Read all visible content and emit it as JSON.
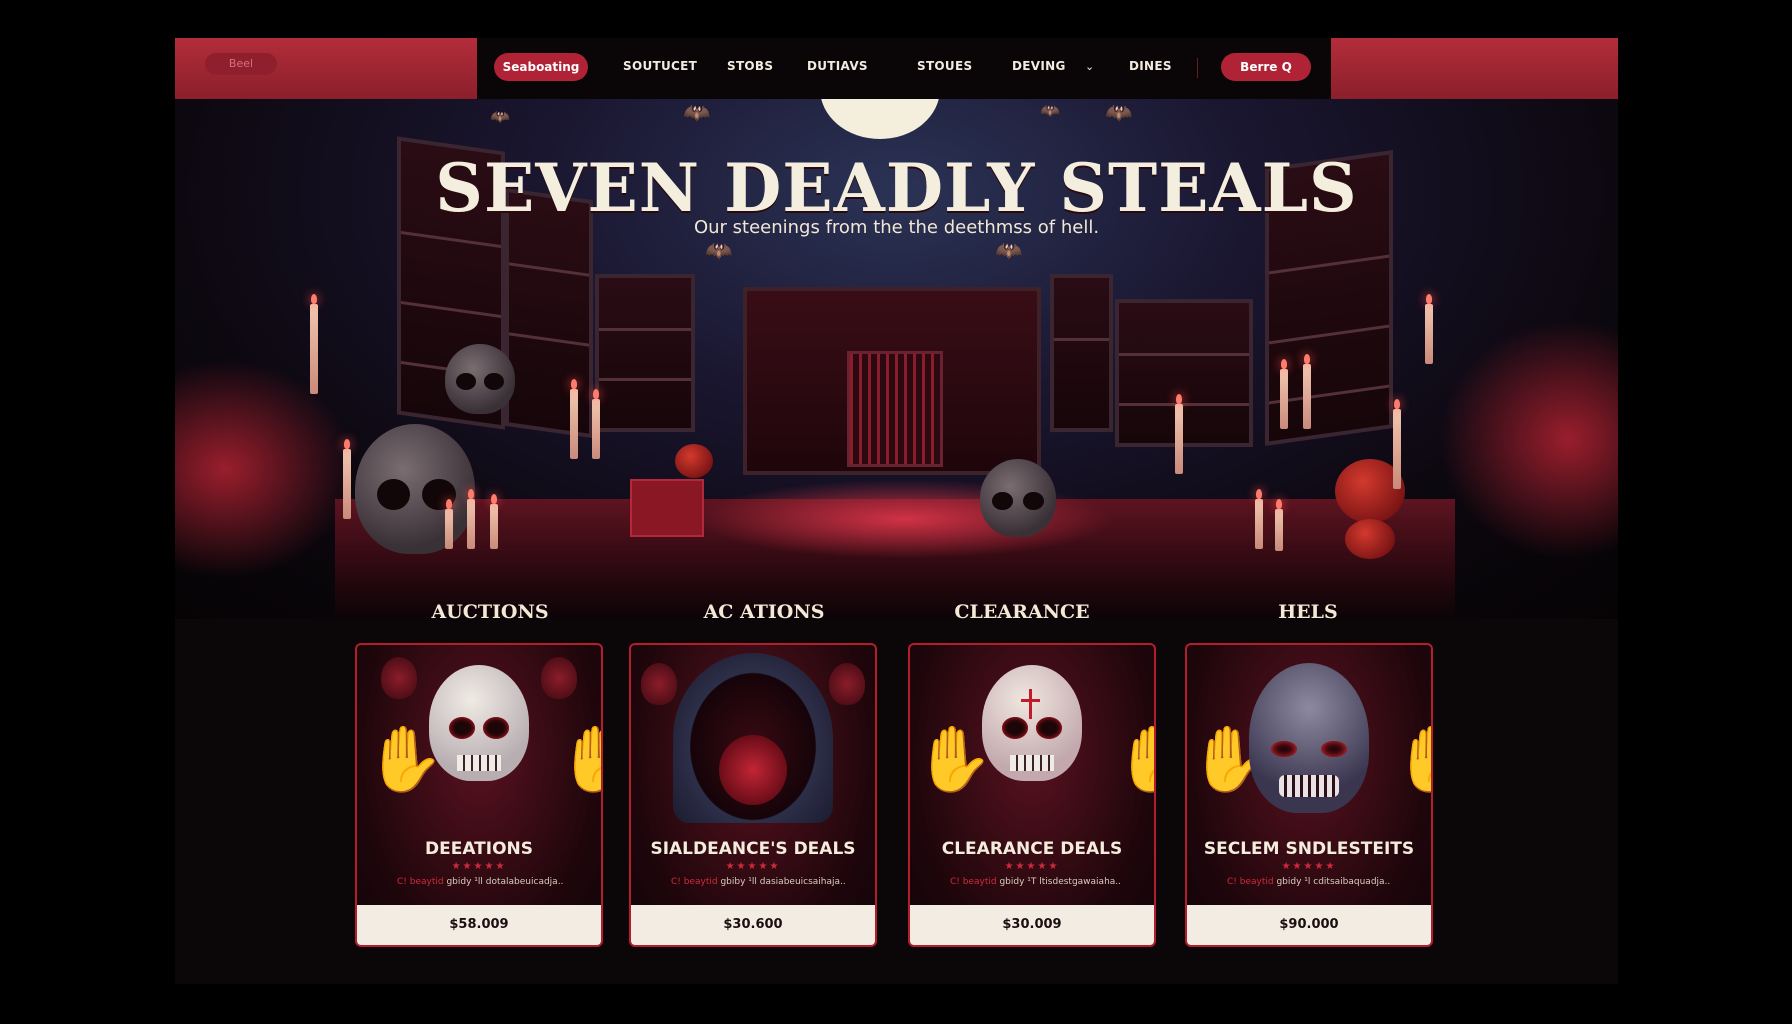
{
  "nav": {
    "logo": "Beel",
    "active_pill": "Seaboating",
    "links": [
      "SOUTUCET",
      "STOBS",
      "DUTIAVS",
      "STOUES",
      "DEVING",
      "DINES"
    ],
    "cta": "Berre Q"
  },
  "hero": {
    "title": "SEVEN DEADLY STEALS",
    "subtitle": "Our steenings from the the deethmss of hell."
  },
  "categories": [
    {
      "title": "AUCTIONS",
      "name": "DEEATIONS",
      "tag": "C! beaytid",
      "desc": "gbidy ¹ll dotalabeuicadja..",
      "price": "$58.009"
    },
    {
      "title": "AC ATIONS",
      "name": "SIALDEANCE'S DEALS",
      "tag": "C! beaytid",
      "desc": "gbiby ¹ll dasiabeuicsaihaja..",
      "price": "$30.600"
    },
    {
      "title": "CLEARANCE",
      "name": "CLEARANCE DEALS",
      "tag": "C! beaytid",
      "desc": "gbidy ¹T ltisdestgawaiaha..",
      "price": "$30.009"
    },
    {
      "title": "HELS",
      "name": "SECLEM SNDLESTEITS",
      "tag": "C! beaytid",
      "desc": "gbidy ¹l cditsaibaquadja..",
      "price": "$90.000"
    }
  ],
  "colors": {
    "accent": "#b02235",
    "background": "#0b0608",
    "text": "#f3e9d8"
  }
}
